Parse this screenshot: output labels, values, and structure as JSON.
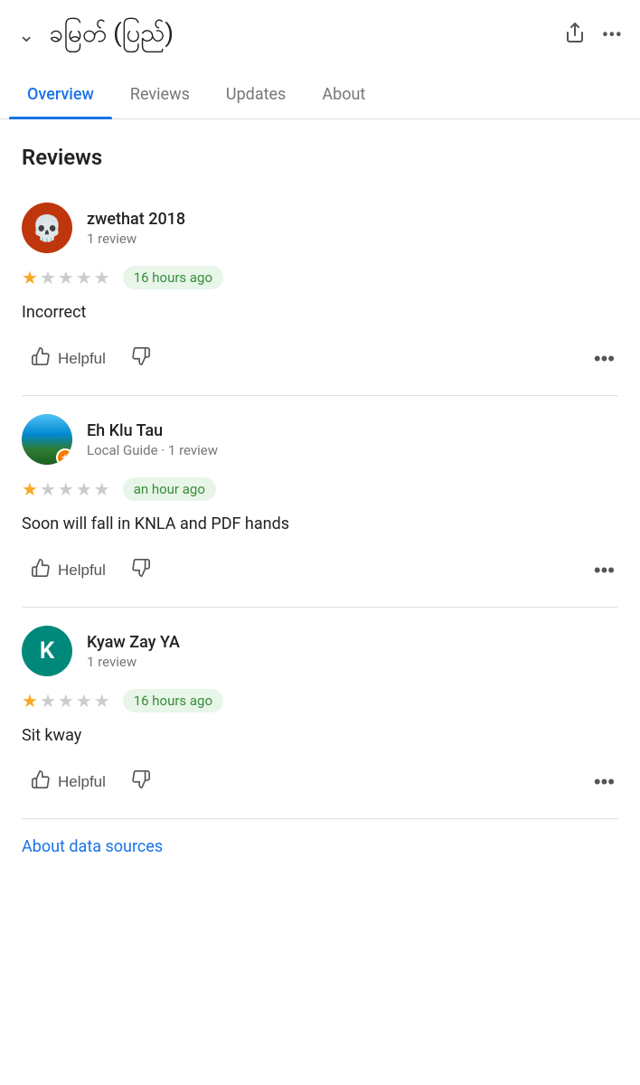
{
  "topBar": {
    "placeTitle": "ခမြတ် (ပြည်)",
    "chevronLabel": "back",
    "shareLabel": "share",
    "moreLabel": "more"
  },
  "tabs": [
    {
      "id": "overview",
      "label": "Overview",
      "active": true
    },
    {
      "id": "reviews",
      "label": "Reviews",
      "active": false
    },
    {
      "id": "updates",
      "label": "Updates",
      "active": false
    },
    {
      "id": "about",
      "label": "About",
      "active": false
    }
  ],
  "reviewsSection": {
    "title": "Reviews",
    "reviews": [
      {
        "id": "review-1",
        "name": "zwethat 2018",
        "meta": "1 review",
        "avatarType": "skull",
        "rating": 1,
        "totalStars": 5,
        "timeAgo": "16 hours ago",
        "text": "Incorrect",
        "helpfulLabel": "Helpful"
      },
      {
        "id": "review-2",
        "name": "Eh Klu Tau",
        "meta": "Local Guide · 1 review",
        "avatarType": "mountain",
        "isLocalGuide": true,
        "rating": 1,
        "totalStars": 5,
        "timeAgo": "an hour ago",
        "text": "Soon will fall in KNLA and PDF hands",
        "helpfulLabel": "Helpful"
      },
      {
        "id": "review-3",
        "name": "Kyaw Zay YA",
        "meta": "1 review",
        "avatarType": "initial",
        "avatarInitial": "K",
        "rating": 1,
        "totalStars": 5,
        "timeAgo": "16 hours ago",
        "text": "Sit kway",
        "helpfulLabel": "Helpful"
      }
    ]
  },
  "footer": {
    "aboutDataSources": "About data sources"
  },
  "icons": {
    "thumbUp": "👍",
    "thumbDown": "👎",
    "share": "⬆",
    "skull": "💀",
    "mountain": "🏔",
    "localGuide": "★"
  },
  "colors": {
    "accent": "#1a73e8",
    "timeBadgeBg": "#e8f5e9",
    "timeBadgeText": "#388e3c",
    "starFilled": "#f9a825",
    "starEmpty": "#ccc"
  }
}
